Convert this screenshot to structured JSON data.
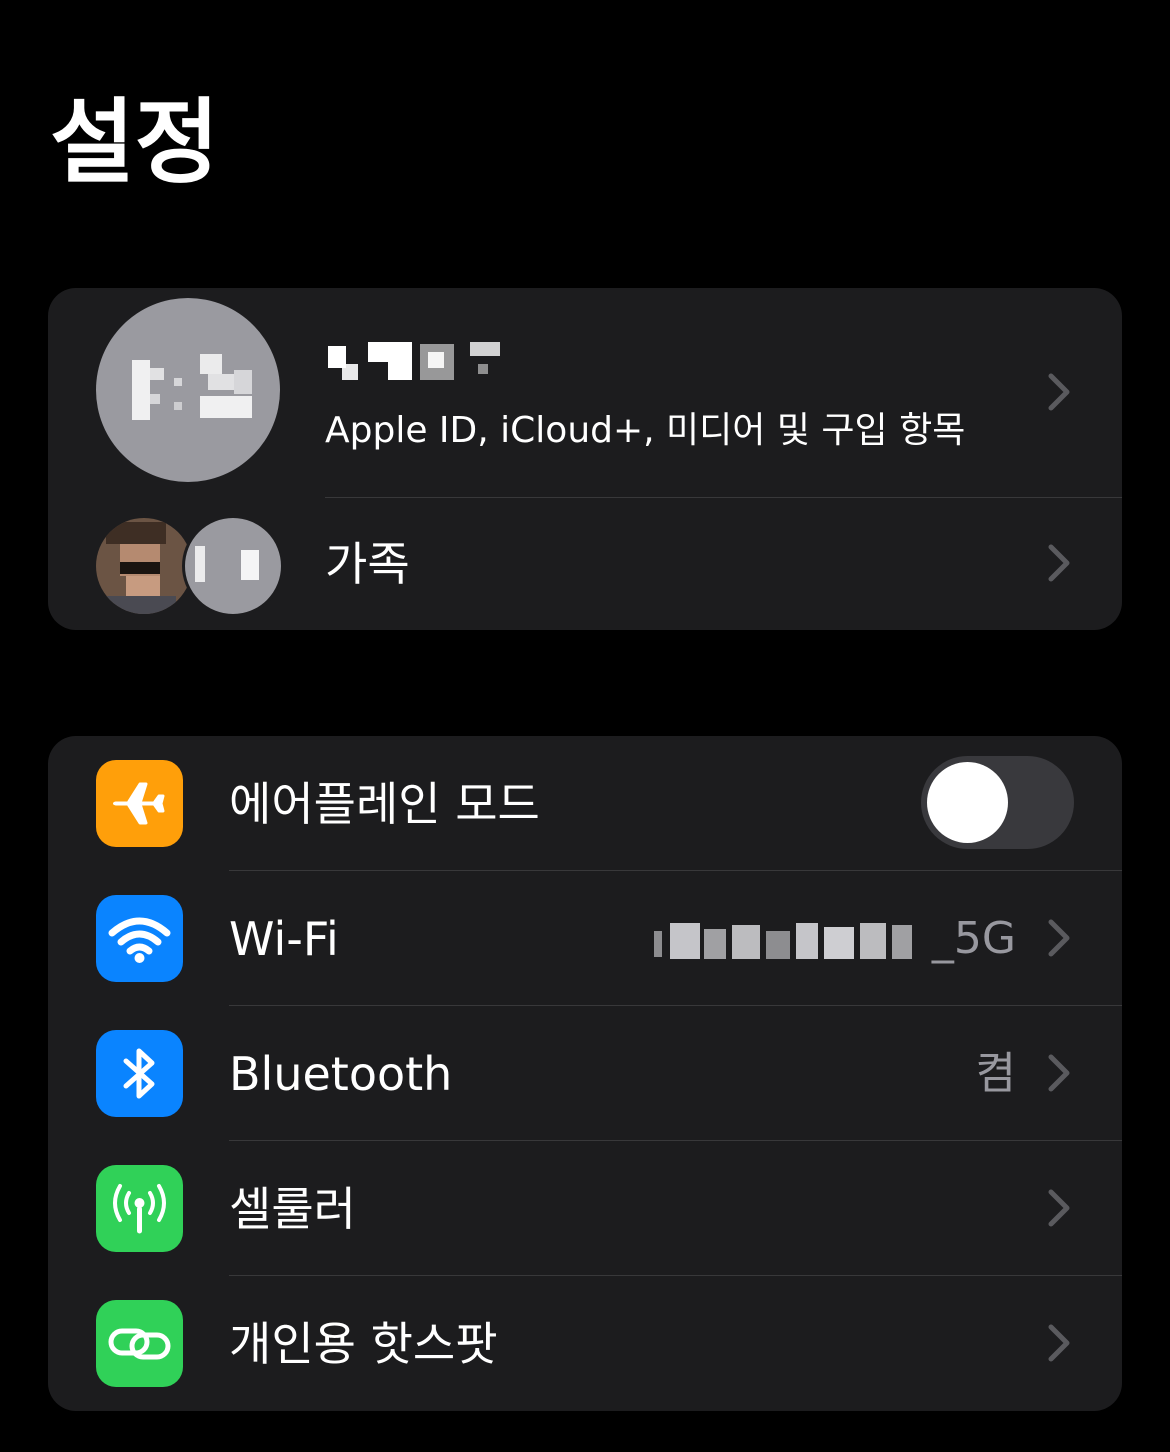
{
  "header": {
    "title": "설정"
  },
  "profile": {
    "name": "",
    "subtitle": "Apple ID, iCloud+, 미디어 및 구입 항목",
    "avatar_icon": "profile-avatar-pixelated",
    "chevron_icon": "chevron-right-icon"
  },
  "family": {
    "label": "가족",
    "avatar_icons": [
      "family-avatar-1",
      "family-avatar-2"
    ],
    "chevron_icon": "chevron-right-icon"
  },
  "settings": {
    "items": [
      {
        "key": "airplane",
        "label": "에어플레인 모드",
        "icon": "airplane-icon",
        "icon_color": "#ff9f0a",
        "control": "toggle",
        "toggle_on": false
      },
      {
        "key": "wifi",
        "label": "Wi-Fi",
        "icon": "wifi-icon",
        "icon_color": "#0a84ff",
        "value_suffix": "_5G",
        "value_obscured": true
      },
      {
        "key": "bluetooth",
        "label": "Bluetooth",
        "icon": "bluetooth-icon",
        "icon_color": "#0a84ff",
        "value": "켬"
      },
      {
        "key": "cellular",
        "label": "셀룰러",
        "icon": "cellular-antenna-icon",
        "icon_color": "#30d158"
      },
      {
        "key": "hotspot",
        "label": "개인용 핫스팟",
        "icon": "hotspot-link-icon",
        "icon_color": "#30d158"
      }
    ]
  },
  "colors": {
    "background": "#000000",
    "group_background": "#1c1c1e",
    "separator": "#38383a",
    "secondary_text": "#98989f",
    "chevron": "#5a5a5e",
    "toggle_off_track": "#39393d"
  }
}
